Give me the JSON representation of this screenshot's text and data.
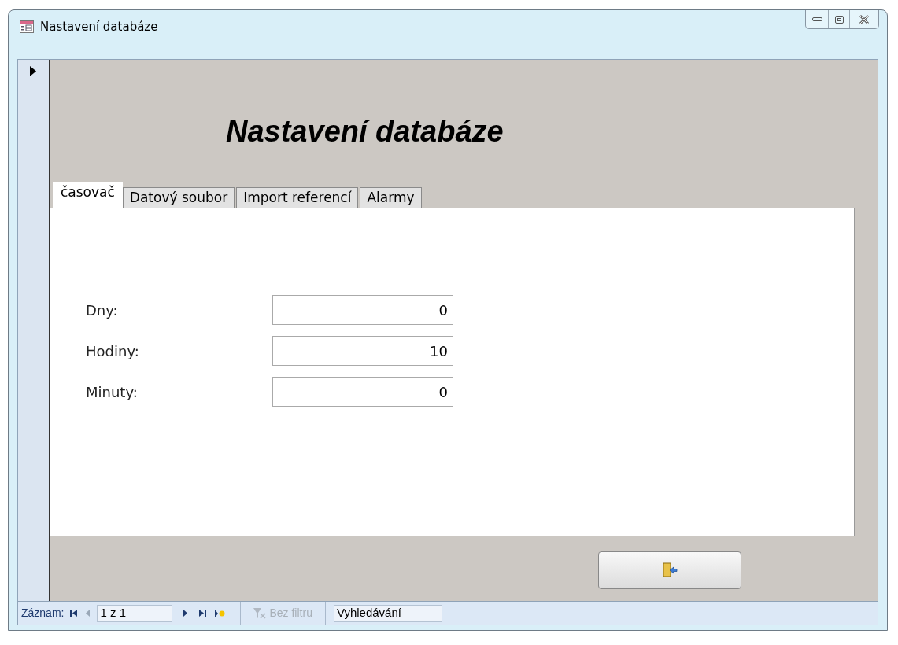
{
  "window": {
    "title": "Nastavení databáze"
  },
  "form": {
    "heading": "Nastavení databáze",
    "tabs": [
      {
        "label": "časovač",
        "selected": true
      },
      {
        "label": "Datový soubor",
        "selected": false
      },
      {
        "label": "Import referencí",
        "selected": false
      },
      {
        "label": "Alarmy",
        "selected": false
      }
    ],
    "fields": [
      {
        "label": "Dny:",
        "value": "0"
      },
      {
        "label": "Hodiny:",
        "value": "10"
      },
      {
        "label": "Minuty:",
        "value": "0"
      }
    ]
  },
  "navigation": {
    "label": "Záznam:",
    "position": "1 z 1",
    "filter": {
      "label": "Bez filtru",
      "disabled": true
    },
    "search": {
      "placeholder": "Vyhledávání"
    }
  }
}
